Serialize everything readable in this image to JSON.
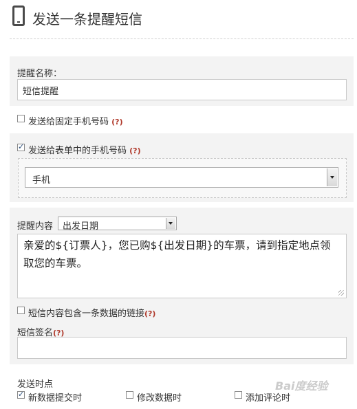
{
  "header": {
    "title": "发送一条提醒短信",
    "icon": "mobile-phone-icon"
  },
  "reminder_name": {
    "label": "提醒名称：",
    "value": "短信提醒"
  },
  "send_fixed": {
    "label": "发送给固定手机号码",
    "help": "(?)",
    "checked": false
  },
  "send_form": {
    "label": "发送给表单中的手机号码",
    "help": "(?)",
    "checked": true,
    "field_value": "手机"
  },
  "content": {
    "label": "提醒内容",
    "insert_field_value": "出发日期",
    "text": "亲爱的${订票人}，您已购${出发日期}的车票，请到指定地点领取您的车票。"
  },
  "include_link": {
    "label": "短信内容包含一条数据的链接",
    "help": "(?)",
    "checked": false
  },
  "signature": {
    "label": "短信签名",
    "help": "(?)",
    "value": ""
  },
  "send_timing": {
    "label": "发送时点",
    "options": [
      {
        "label": "新数据提交时",
        "checked": true
      },
      {
        "label": "修改数据时",
        "checked": false
      },
      {
        "label": "添加评论时",
        "checked": false
      }
    ]
  },
  "watermark": "Bai度经验"
}
